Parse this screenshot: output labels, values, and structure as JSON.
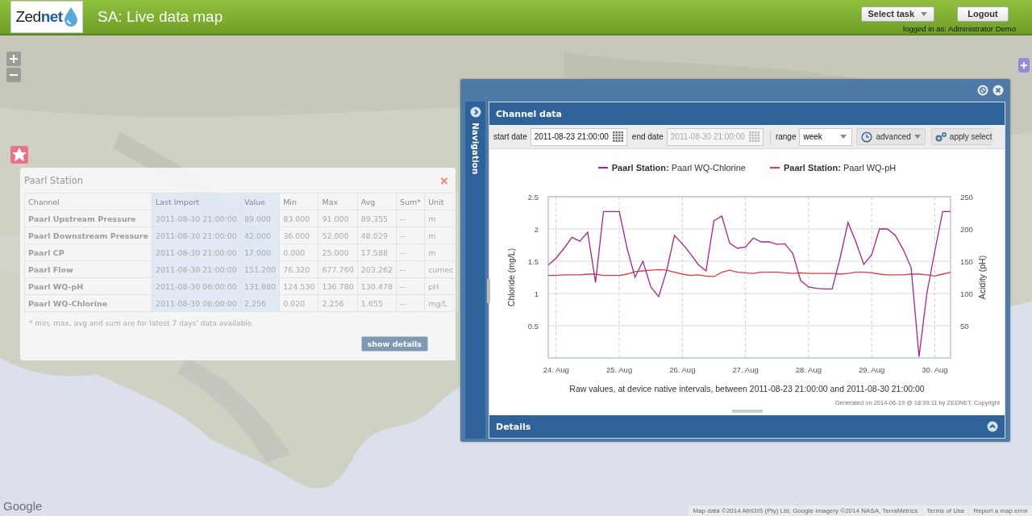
{
  "header": {
    "logo": [
      {
        "text": "Zed",
        "color": "#222222"
      },
      {
        "text": "net",
        "color": "#1d5aa0"
      }
    ],
    "title": "SA: Live data map",
    "task_select": "Select task",
    "logout": "Logout",
    "user": "logged in as: Administrator Demo"
  },
  "map": {
    "kind": "picture",
    "logo": "Google",
    "attribution": [
      "Map data ©2014 AfriGIS (Pty) Ltd, Google Imagery ©2014 NASA, TerraMetrics",
      "Terms of Use",
      "Report a map error"
    ]
  },
  "station_popup": {
    "title": "Paarl Station",
    "close": "×",
    "columns": [
      {
        "label": "Channel",
        "highlighted": false
      },
      {
        "label": "Last Import",
        "highlighted": true
      },
      {
        "label": "Value",
        "highlighted": true
      },
      {
        "label": "Min",
        "highlighted": false
      },
      {
        "label": "Max",
        "highlighted": false
      },
      {
        "label": "Avg",
        "highlighted": false
      },
      {
        "label": "Sum*",
        "highlighted": false
      },
      {
        "label": "Unit",
        "highlighted": false
      }
    ],
    "rows": [
      [
        "Paarl Upstream Pressure",
        "2011-08-30 21:00:00",
        "89.000",
        "83.000",
        "91.000",
        "89.355",
        "--",
        "m"
      ],
      [
        "Paarl Downstream Pressure",
        "2011-08-30 21:00:00",
        "42.000",
        "36.000",
        "52.000",
        "48.029",
        "--",
        "m"
      ],
      [
        "Paarl CP",
        "2011-08-30 21:00:00",
        "17.000",
        "0.000",
        "25.000",
        "17.588",
        "--",
        "m"
      ],
      [
        "Paarl Flow",
        "2011-08-30 21:00:00",
        "151.200",
        "76.320",
        "677.760",
        "203.262",
        "--",
        "cumec"
      ],
      [
        "Paarl WQ-pH",
        "2011-08-30 06:00:00",
        "131.880",
        "124.530",
        "136.780",
        "130.478",
        "--",
        "pH"
      ],
      [
        "Paarl WQ-Chlorine",
        "2011-08-30 06:00:00",
        "2.256",
        "0.020",
        "2.256",
        "1.655",
        "--",
        "mg/L"
      ]
    ],
    "footnote": "* min, max, avg and sum are for latest 7 days' data available.",
    "button": "show details"
  },
  "channel_window": {
    "navigation": "Navigation",
    "panel_title": "Channel data",
    "toolbar": {
      "start_label": "start date",
      "start_value": "2011-08-23 21:00:00",
      "end_label": "end date",
      "end_value": "2011-08-30 21:00:00",
      "end_disabled": true,
      "range_label": "range",
      "range_value": "week",
      "advanced": "advanced",
      "apply": "apply select"
    },
    "chart_data": {
      "type": "line",
      "grid": true,
      "legend": "top",
      "categories": [
        null,
        "24. Aug",
        null,
        null,
        null,
        null,
        null,
        null,
        null,
        "25. Aug",
        null,
        null,
        null,
        null,
        null,
        null,
        null,
        "26. Aug",
        null,
        null,
        null,
        null,
        null,
        null,
        null,
        "27. Aug",
        null,
        null,
        null,
        null,
        null,
        null,
        null,
        "28. Aug",
        null,
        null,
        null,
        null,
        null,
        null,
        null,
        "29. Aug",
        null,
        null,
        null,
        null,
        null,
        null,
        null,
        "30. Aug",
        null,
        null
      ],
      "ylabel": "Chloride (mg/L)",
      "ylim": [
        0,
        2.5
      ],
      "yticks": [
        0.5,
        1,
        1.5,
        2,
        2.5
      ],
      "y2label": "Acidity (pH)",
      "y2lim": [
        0,
        250
      ],
      "y2ticks": [
        50,
        100,
        150,
        200,
        250
      ],
      "series": [
        {
          "name": "**Paarl Station:** Paarl WQ-Chlorine",
          "color": "#a3268e",
          "values": [
            1.44,
            1.55,
            1.7,
            1.87,
            1.81,
            1.95,
            1.17,
            2.27,
            2.27,
            2.27,
            1.7,
            1.25,
            1.5,
            1.1,
            0.95,
            1.35,
            1.9,
            1.77,
            1.62,
            1.45,
            1.35,
            2.13,
            2.2,
            1.78,
            1.7,
            1.72,
            1.86,
            1.8,
            1.8,
            1.76,
            1.77,
            1.62,
            1.2,
            1.1,
            1.08,
            1.07,
            1.07,
            1.55,
            2.1,
            1.8,
            1.45,
            1.6,
            2.0,
            2.0,
            1.9,
            1.68,
            1.4,
            0.02,
            1.0,
            1.65,
            2.27,
            2.27
          ]
        },
        {
          "name": "**Paarl Station:** Paarl WQ-pH",
          "color": "#e5373c",
          "axis": "y2",
          "values": [
            128,
            128,
            129,
            129,
            129,
            130,
            130,
            128,
            128,
            128,
            130,
            134,
            135,
            136,
            137,
            136,
            133,
            130,
            128,
            129,
            127,
            126,
            133,
            136,
            133,
            132,
            131,
            133,
            133,
            133,
            132,
            131,
            132,
            131,
            131,
            131,
            131,
            130,
            131,
            133,
            133,
            132,
            130,
            129,
            129,
            129,
            130,
            130,
            129,
            127,
            130,
            133
          ]
        }
      ]
    },
    "chart_caption": "Raw values, at device native intervals, between 2011-08-23 21:00:00 and 2011-08-30 21:00:00",
    "chart_credits": "Generated on 2014-06-19 @ 18:39:11 by ZEDNET, Copyright",
    "details": "Details"
  }
}
